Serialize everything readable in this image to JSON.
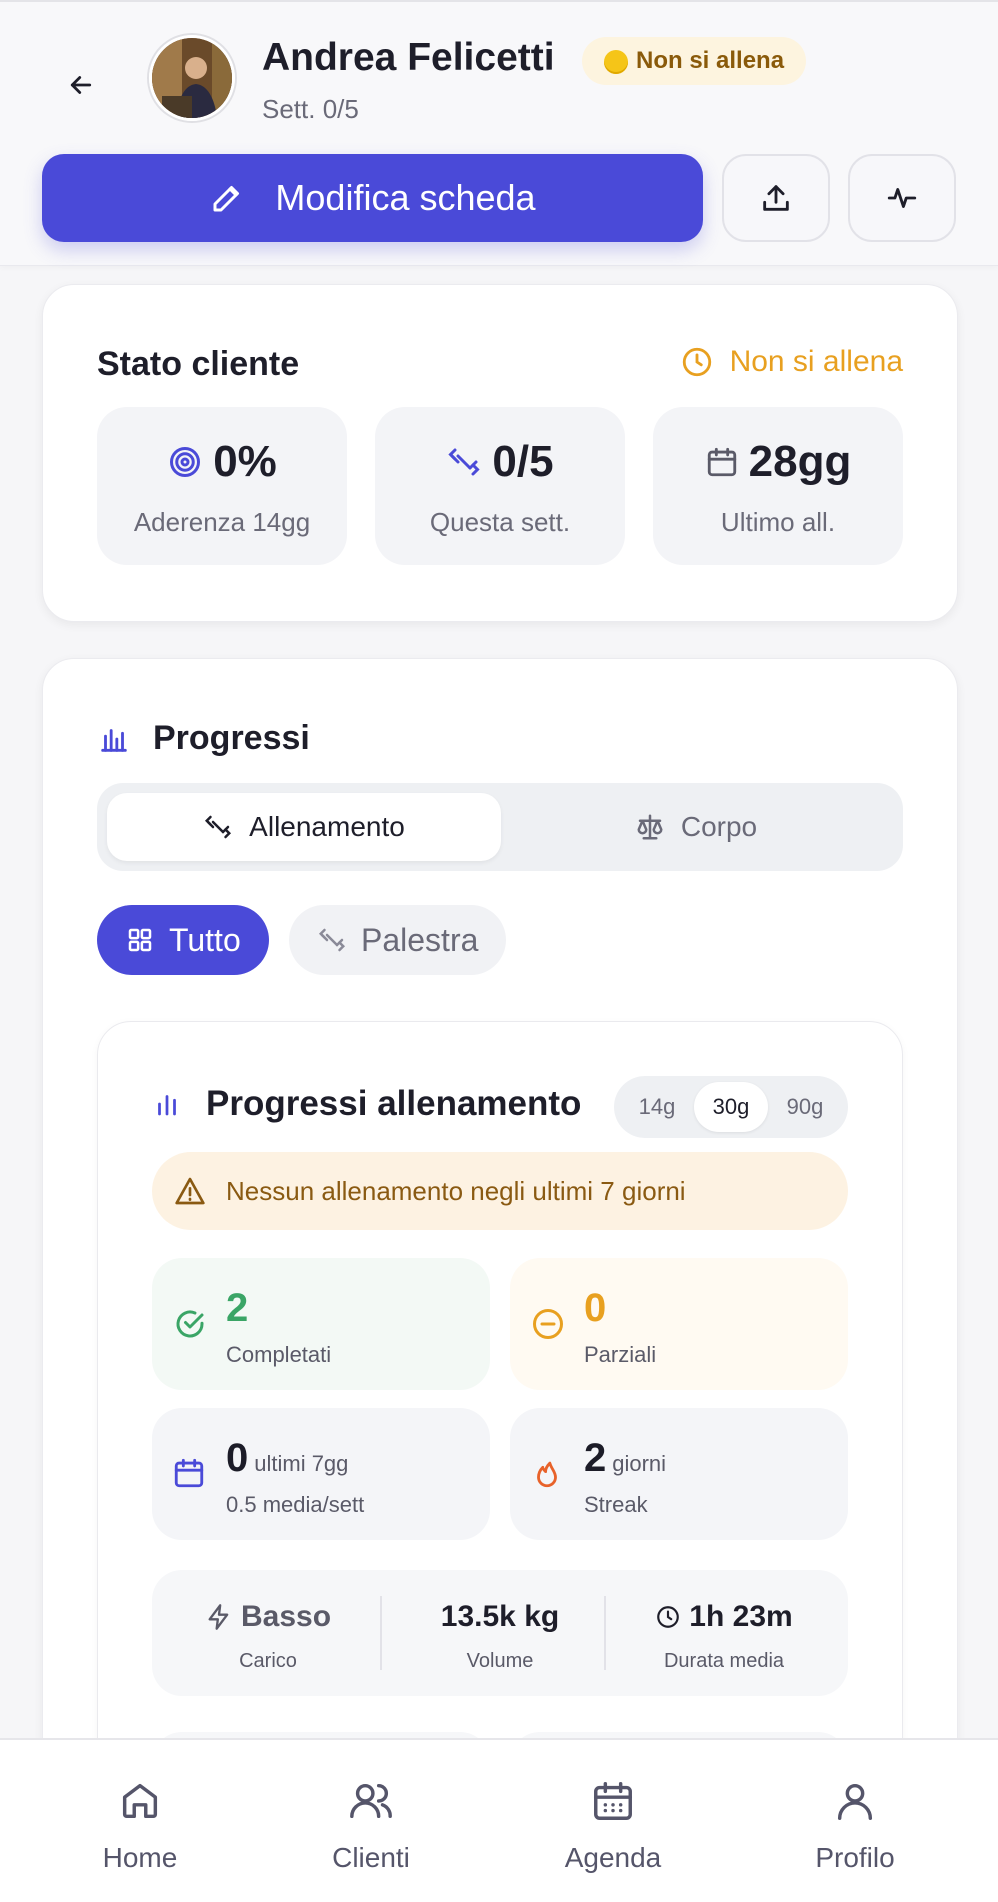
{
  "header": {
    "name": "Andrea Felicetti",
    "badge": "Non si allena",
    "week": "Sett. 0/5",
    "edit_button": "Modifica scheda",
    "export_icon": "upload-icon",
    "activity_icon": "activity-icon"
  },
  "stato": {
    "title": "Stato cliente",
    "status": "Non si allena",
    "stats": [
      {
        "value": "0%",
        "label": "Aderenza 14gg",
        "icon": "target-icon"
      },
      {
        "value": "0/5",
        "label": "Questa sett.",
        "icon": "dumbbell-icon"
      },
      {
        "value": "28gg",
        "label": "Ultimo all.",
        "icon": "calendar-icon"
      }
    ]
  },
  "progressi": {
    "title": "Progressi",
    "tabs": [
      {
        "label": "Allenamento",
        "active": true
      },
      {
        "label": "Corpo",
        "active": false
      }
    ],
    "filters": [
      {
        "label": "Tutto",
        "active": true
      },
      {
        "label": "Palestra",
        "active": false
      }
    ],
    "card": {
      "title": "Progressi allenamento",
      "ranges": [
        "14g",
        "30g",
        "90g"
      ],
      "active_range": "30g",
      "alert": "Nessun allenamento negli ultimi 7 giorni",
      "metrics": [
        {
          "value": "2",
          "unit": "",
          "label": "Completati",
          "color": "#3aa566"
        },
        {
          "value": "0",
          "unit": "",
          "label": "Parziali",
          "color": "#e8a020"
        },
        {
          "value": "0",
          "unit": "ultimi 7gg",
          "label": "0.5 media/sett",
          "color": "#1e1e2a"
        },
        {
          "value": "2",
          "unit": "giorni",
          "label": "Streak",
          "color": "#1e1e2a"
        }
      ],
      "summary": [
        {
          "value": "Basso",
          "label": "Carico"
        },
        {
          "value": "13.5k kg",
          "label": "Volume"
        },
        {
          "value": "1h 23m",
          "label": "Durata media"
        }
      ]
    }
  },
  "nav": [
    "Home",
    "Clienti",
    "Agenda",
    "Profilo"
  ],
  "colors": {
    "accent": "#4a4ad8",
    "warning": "#e8a020",
    "success": "#3aa566",
    "danger": "#e8622a"
  }
}
